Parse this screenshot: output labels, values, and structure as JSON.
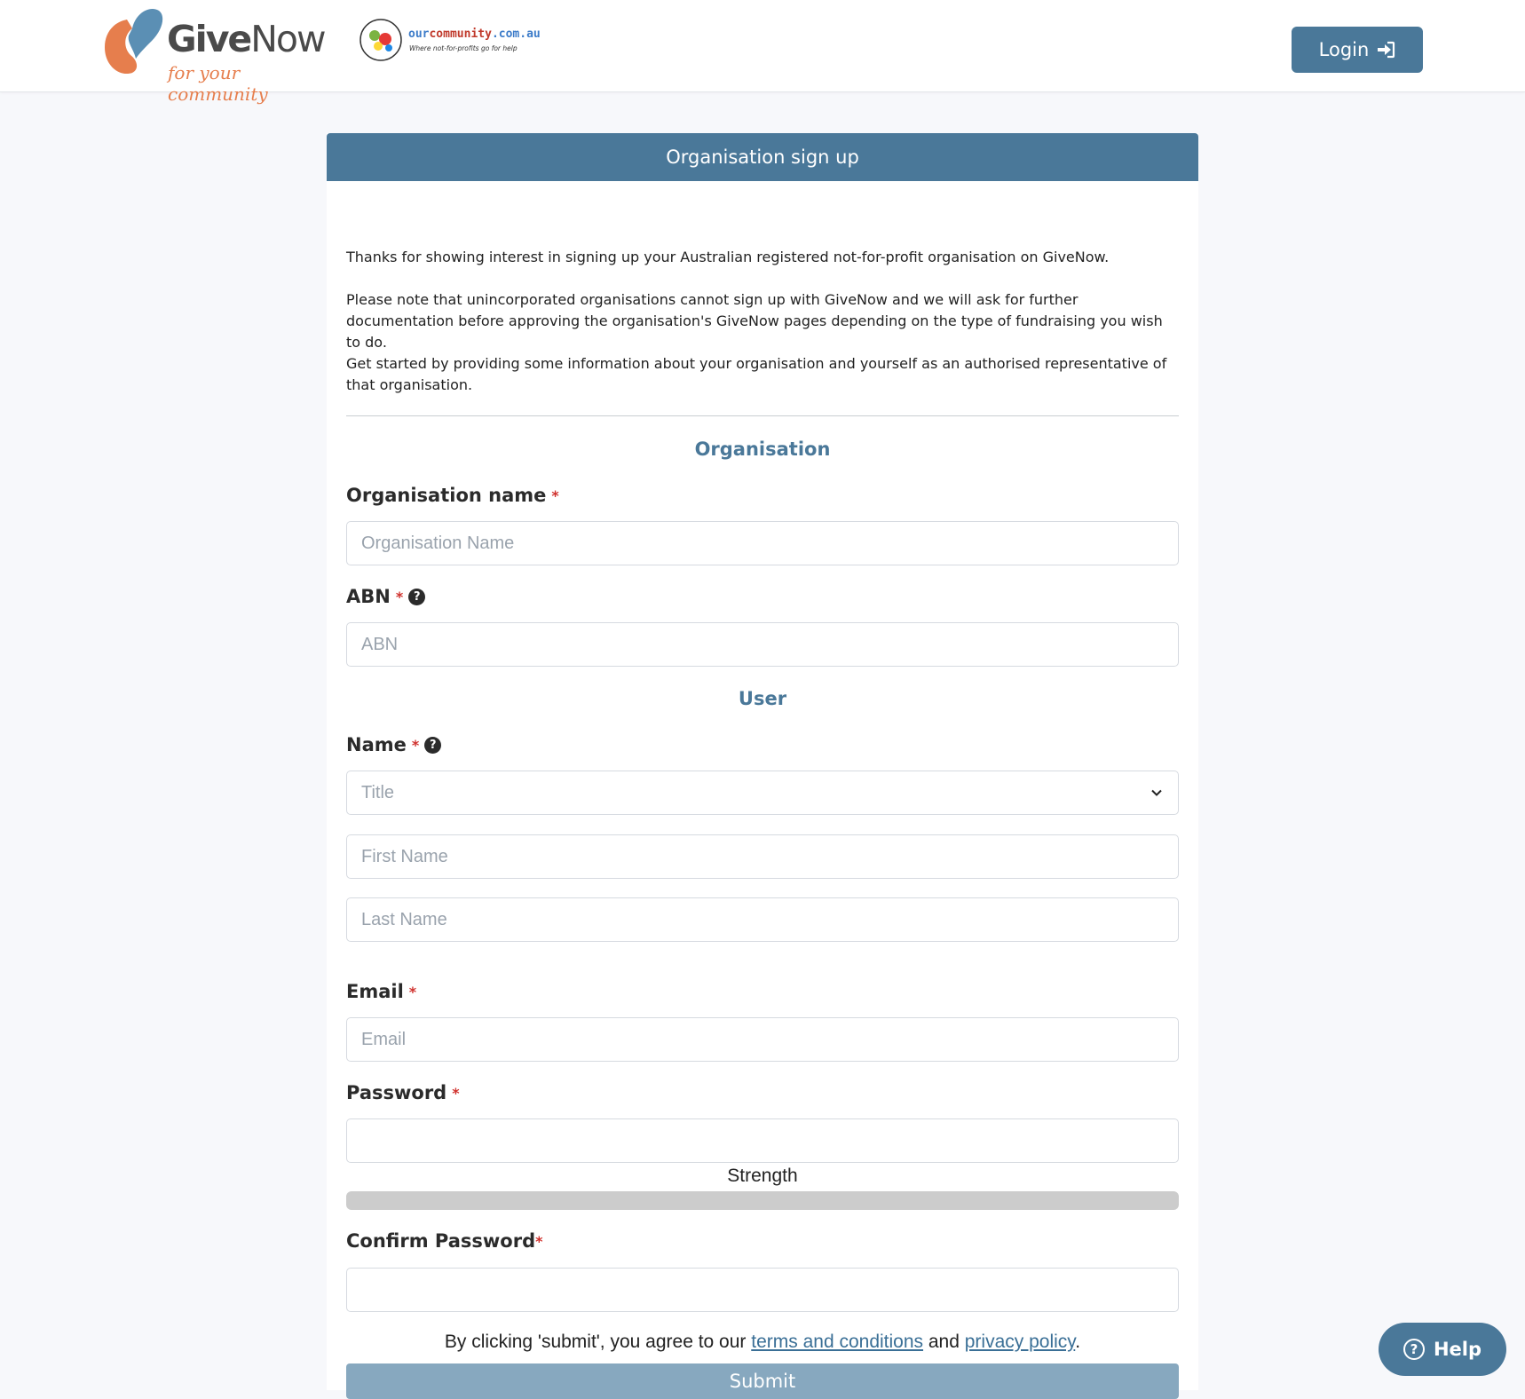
{
  "header": {
    "logo": {
      "word_give": "Give",
      "word_now": "Now",
      "tagline": "for your community"
    },
    "partner_logo": {
      "our": "our",
      "community": "community",
      "domain": ".com.au",
      "tagline": "Where not-for-profits go for help"
    },
    "login_label": "Login",
    "brand_color": "#4a7899"
  },
  "card": {
    "title": "Organisation sign up",
    "intro": [
      "Thanks for showing interest in signing up your Australian registered not-for-profit organisation on GiveNow.",
      "Please note that unincorporated organisations cannot sign up with GiveNow and we will ask for further documentation before approving the organisation's GiveNow pages depending on the type of fundraising you wish to do.",
      "Get started by providing some information about your organisation and yourself as an authorised representative of that organisation."
    ],
    "sections": {
      "organisation": "Organisation",
      "user": "User"
    },
    "fields": {
      "org_name": {
        "label": "Organisation name",
        "required": "*",
        "placeholder": "Organisation Name"
      },
      "abn": {
        "label": "ABN",
        "required": "*",
        "placeholder": "ABN"
      },
      "name": {
        "label": "Name",
        "required": "*"
      },
      "title": {
        "placeholder": "Title"
      },
      "first_name": {
        "placeholder": "First Name"
      },
      "last_name": {
        "placeholder": "Last Name"
      },
      "email": {
        "label": "Email",
        "required": "*",
        "placeholder": "Email"
      },
      "password": {
        "label": "Password",
        "required": "*",
        "placeholder": ""
      },
      "strength_label": "Strength",
      "confirm_password": {
        "label": "Confirm Password",
        "required": "*",
        "placeholder": ""
      }
    },
    "agree": {
      "prefix": "By clicking 'submit', you agree to our ",
      "terms": "terms and conditions",
      "middle": " and ",
      "privacy": "privacy policy",
      "suffix": "."
    },
    "submit_label": "Submit"
  },
  "help": {
    "label": "Help"
  }
}
